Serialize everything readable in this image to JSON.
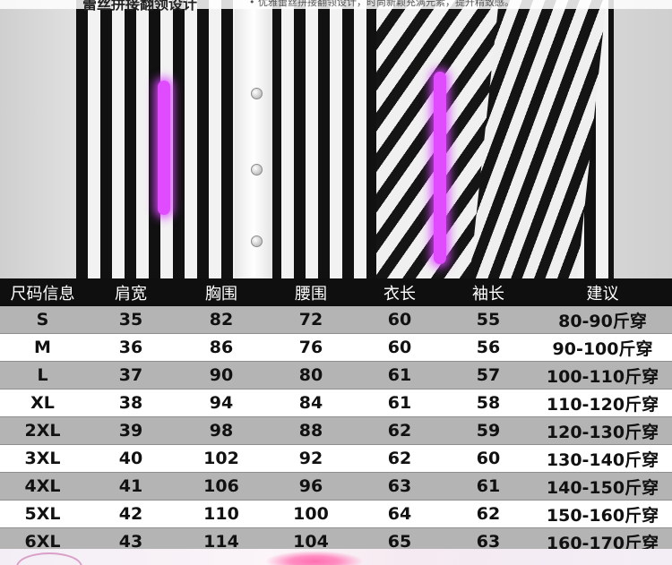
{
  "caption": {
    "title": "蕾丝拼接翻领设计",
    "text": "• 优雅蕾丝拼接翻领设计，时尚新颖充满元素，提升精致感。"
  },
  "table": {
    "headers": [
      "尺码信息",
      "肩宽",
      "胸围",
      "腰围",
      "衣长",
      "袖长",
      "建议"
    ],
    "rows": [
      [
        "S",
        "35",
        "82",
        "72",
        "60",
        "55",
        "80-90斤穿"
      ],
      [
        "M",
        "36",
        "86",
        "76",
        "60",
        "56",
        "90-100斤穿"
      ],
      [
        "L",
        "37",
        "90",
        "80",
        "61",
        "57",
        "100-110斤穿"
      ],
      [
        "XL",
        "38",
        "94",
        "84",
        "61",
        "58",
        "110-120斤穿"
      ],
      [
        "2XL",
        "39",
        "98",
        "88",
        "62",
        "59",
        "120-130斤穿"
      ],
      [
        "3XL",
        "40",
        "102",
        "92",
        "62",
        "60",
        "130-140斤穿"
      ],
      [
        "4XL",
        "41",
        "106",
        "96",
        "63",
        "61",
        "140-150斤穿"
      ],
      [
        "5XL",
        "42",
        "110",
        "100",
        "64",
        "62",
        "150-160斤穿"
      ],
      [
        "6XL",
        "43",
        "114",
        "104",
        "65",
        "63",
        "160-170斤穿"
      ]
    ]
  },
  "colors": {
    "header_bg": "#0f0f0f",
    "row_shaded": "#b4b4b4",
    "row_plain": "#ffffff",
    "highlight_glow": "#e04bff"
  }
}
